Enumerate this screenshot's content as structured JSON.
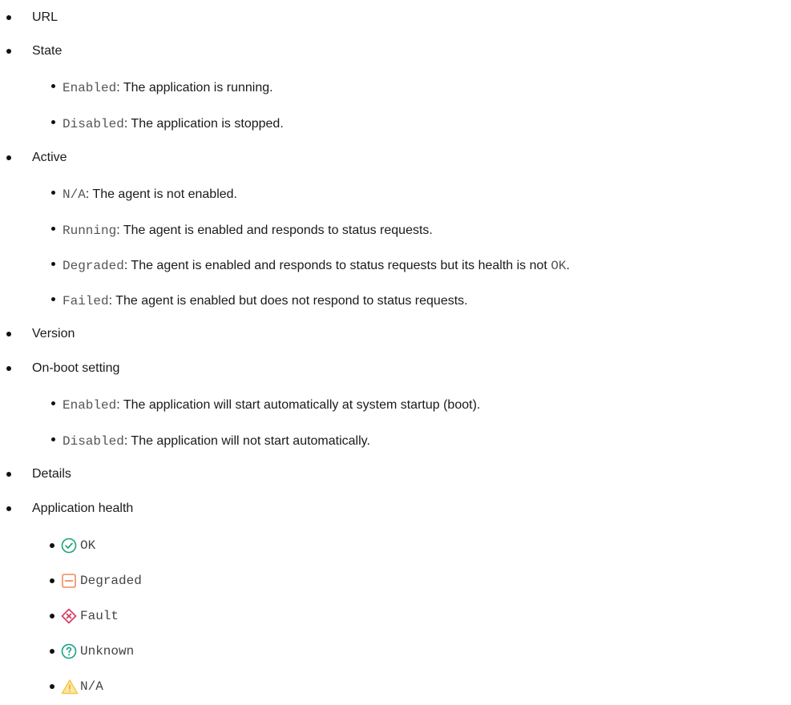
{
  "items": [
    {
      "label": "URL"
    },
    {
      "label": "State",
      "children": [
        {
          "code": "Enabled",
          "text": ": The application is running."
        },
        {
          "code": "Disabled",
          "text": ": The application is stopped."
        }
      ]
    },
    {
      "label": "Active",
      "children": [
        {
          "code": "N/A",
          "text": ": The agent is not enabled."
        },
        {
          "code": "Running",
          "text": ": The agent is enabled and responds to status requests."
        },
        {
          "code": "Degraded",
          "text": ": The agent is enabled and responds to status requests but its health is not ",
          "code2": "OK",
          "text2": "."
        },
        {
          "code": "Failed",
          "text": ": The agent is enabled but does not respond to status requests."
        }
      ]
    },
    {
      "label": "Version"
    },
    {
      "label": "On-boot setting",
      "children": [
        {
          "code": "Enabled",
          "text": ": The application will start automatically at system startup (boot)."
        },
        {
          "code": "Disabled",
          "text": ": The application will not start automatically."
        }
      ]
    },
    {
      "label": "Details"
    },
    {
      "label": "Application health",
      "health": [
        {
          "icon": "ok-check-icon",
          "label": "OK",
          "color": "#1aa37a"
        },
        {
          "icon": "degraded-minus-icon",
          "label": "Degraded",
          "color": "#ef8a5c"
        },
        {
          "icon": "fault-x-icon",
          "label": "Fault",
          "color": "#d6365c"
        },
        {
          "icon": "unknown-question-icon",
          "label": "Unknown",
          "color": "#17a084"
        },
        {
          "icon": "warning-triangle-icon",
          "label": "N/A",
          "color": "#f5c542"
        }
      ]
    }
  ]
}
